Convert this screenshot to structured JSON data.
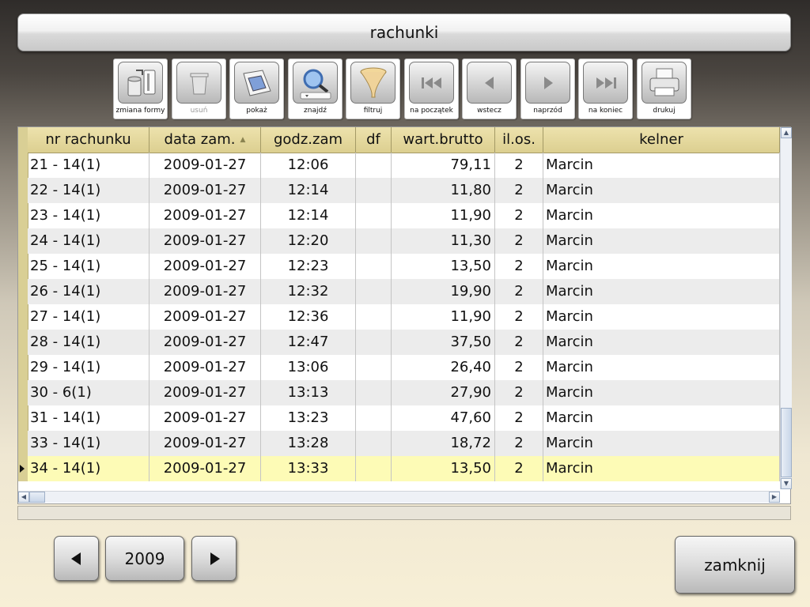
{
  "title": "rachunki",
  "toolbar": [
    {
      "label": "zmiana formy",
      "icon": "change-form-icon",
      "enabled": true
    },
    {
      "label": "usuń",
      "icon": "trash-icon",
      "enabled": false
    },
    {
      "label": "pokaż",
      "icon": "show-icon",
      "enabled": true
    },
    {
      "label": "znajdź",
      "icon": "magnifier-icon",
      "enabled": true
    },
    {
      "label": "filtruj",
      "icon": "funnel-icon",
      "enabled": true
    },
    {
      "label": "na początek",
      "icon": "first-record-icon",
      "enabled": true
    },
    {
      "label": "wstecz",
      "icon": "previous-icon",
      "enabled": true
    },
    {
      "label": "naprzód",
      "icon": "next-icon",
      "enabled": true
    },
    {
      "label": "na koniec",
      "icon": "last-record-icon",
      "enabled": true
    },
    {
      "label": "drukuj",
      "icon": "printer-icon",
      "enabled": true
    }
  ],
  "grid": {
    "columns": [
      "nr rachunku",
      "data zam.",
      "godz.zam",
      "df",
      "wart.brutto",
      "il.os.",
      "kelner"
    ],
    "sorted_column": "data zam.",
    "rows": [
      [
        "21 - 14(1)",
        "2009-01-27",
        "12:06",
        "",
        "79,11",
        "2",
        "Marcin"
      ],
      [
        "22 - 14(1)",
        "2009-01-27",
        "12:14",
        "",
        "11,80",
        "2",
        "Marcin"
      ],
      [
        "23 - 14(1)",
        "2009-01-27",
        "12:14",
        "",
        "11,90",
        "2",
        "Marcin"
      ],
      [
        "24 - 14(1)",
        "2009-01-27",
        "12:20",
        "",
        "11,30",
        "2",
        "Marcin"
      ],
      [
        "25 - 14(1)",
        "2009-01-27",
        "12:23",
        "",
        "13,50",
        "2",
        "Marcin"
      ],
      [
        "26 - 14(1)",
        "2009-01-27",
        "12:32",
        "",
        "19,90",
        "2",
        "Marcin"
      ],
      [
        "27 - 14(1)",
        "2009-01-27",
        "12:36",
        "",
        "11,90",
        "2",
        "Marcin"
      ],
      [
        "28 - 14(1)",
        "2009-01-27",
        "12:47",
        "",
        "37,50",
        "2",
        "Marcin"
      ],
      [
        "29 - 14(1)",
        "2009-01-27",
        "13:06",
        "",
        "26,40",
        "2",
        "Marcin"
      ],
      [
        "30 - 6(1)",
        "2009-01-27",
        "13:13",
        "",
        "27,90",
        "2",
        "Marcin"
      ],
      [
        "31 - 14(1)",
        "2009-01-27",
        "13:23",
        "",
        "47,60",
        "2",
        "Marcin"
      ],
      [
        "33 - 14(1)",
        "2009-01-27",
        "13:28",
        "",
        "18,72",
        "2",
        "Marcin"
      ],
      [
        "34 - 14(1)",
        "2009-01-27",
        "13:33",
        "",
        "13,50",
        "2",
        "Marcin"
      ]
    ],
    "selected_row": 12
  },
  "year_nav": {
    "year": "2009"
  },
  "close_label": "zamknij",
  "colors": {
    "header_bg": "#dccf90",
    "selected_row": "#fdfbb6",
    "alt_row": "#ececec"
  }
}
